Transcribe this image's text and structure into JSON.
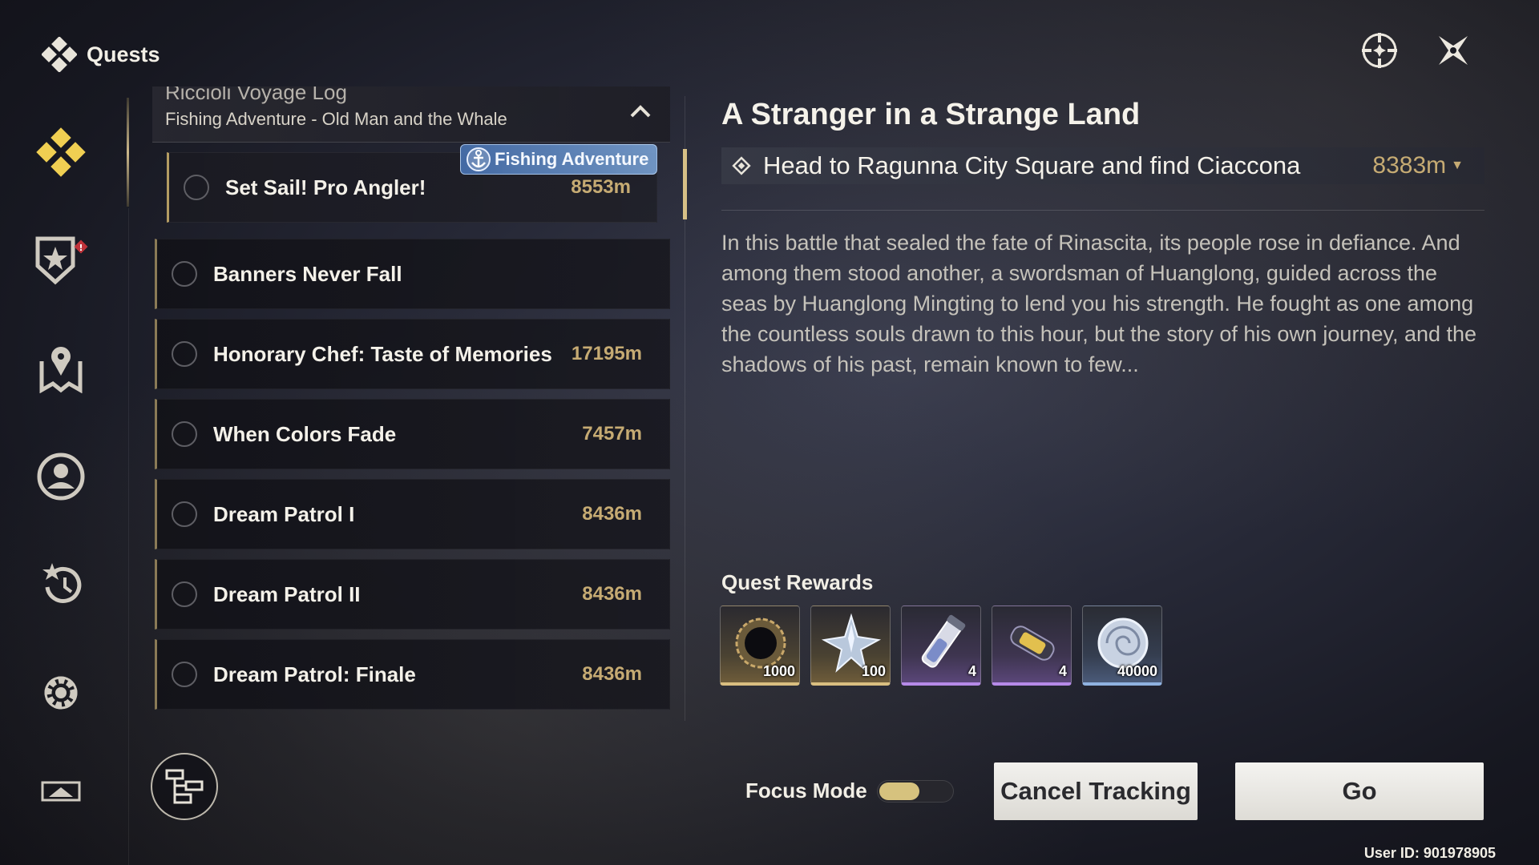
{
  "header": {
    "title": "Quests"
  },
  "top_icons": [
    "target-icon",
    "close-icon"
  ],
  "sidebar": {
    "items": [
      {
        "name": "quest-diamond-icon",
        "active": true
      },
      {
        "name": "shield-star-icon",
        "alert": "!"
      },
      {
        "name": "map-pin-icon"
      },
      {
        "name": "character-icon"
      },
      {
        "name": "replay-star-icon"
      },
      {
        "name": "settings-gear-icon"
      },
      {
        "name": "screen-icon"
      }
    ]
  },
  "quest_list": {
    "group_title": "Riccioli Voyage Log",
    "group_subtitle": "Fishing Adventure - Old Man and the Whale",
    "tag": "Fishing Adventure",
    "subquest": {
      "name": "Set Sail! Pro Angler!",
      "distance": "8553m"
    },
    "quests": [
      {
        "name": "Banners Never Fall",
        "distance": ""
      },
      {
        "name": "Honorary Chef: Taste of Memories",
        "distance": "17195m"
      },
      {
        "name": "When Colors Fade",
        "distance": "7457m"
      },
      {
        "name": "Dream Patrol I",
        "distance": "8436m"
      },
      {
        "name": "Dream Patrol II",
        "distance": "8436m"
      },
      {
        "name": "Dream Patrol: Finale",
        "distance": "8436m"
      }
    ]
  },
  "detail": {
    "title": "A Stranger in a Strange Land",
    "objective": "Head to Ragunna City Square and find Ciaccona",
    "objective_distance": "8383m",
    "description": "In this battle that sealed the fate of Rinascita, its people rose in defiance. And among them stood another, a swordsman of Huanglong, guided across the seas by Huanglong Mingting to lend you his strength. He fought as one among the countless souls drawn to this hour, but the story of his own journey, and the shadows of his past, remain known to few...",
    "rewards_label": "Quest Rewards",
    "rewards": [
      {
        "icon": "dark-ring-icon",
        "qty": "1000",
        "rarity": "gold"
      },
      {
        "icon": "crystal-star-icon",
        "qty": "100",
        "rarity": "gold"
      },
      {
        "icon": "potion-vial-icon",
        "qty": "4",
        "rarity": "purple"
      },
      {
        "icon": "energy-capsule-icon",
        "qty": "4",
        "rarity": "purple"
      },
      {
        "icon": "shell-coin-icon",
        "qty": "40000",
        "rarity": "blue"
      }
    ]
  },
  "footer": {
    "focus_mode_label": "Focus Mode",
    "focus_mode_on": true,
    "cancel_label": "Cancel Tracking",
    "go_label": "Go",
    "user_id": "User ID: 901978905"
  },
  "colors": {
    "accent_gold": "#c6ab73",
    "selected_bar": "#d7c086",
    "alert_red": "#c0333a"
  }
}
